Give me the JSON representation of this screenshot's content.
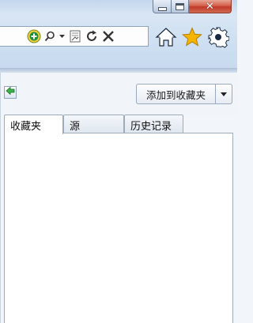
{
  "window": {
    "controls": {
      "minimize_icon": "minimize-icon",
      "maximize_icon": "restore-icon",
      "close_icon": "close-icon",
      "close_glyph": "✕"
    },
    "close_color": "#c0392b"
  },
  "address_bar": {
    "icons": [
      "add-site-icon",
      "search-icon",
      "dropdown-icon",
      "compat-view-icon",
      "refresh-icon",
      "stop-icon"
    ]
  },
  "toolbar": {
    "icons": [
      "home-icon",
      "favorites-star-icon",
      "settings-gear-icon"
    ],
    "star_color": "#f5b400"
  },
  "favorites_center": {
    "back_icon": "green-back-arrow-icon",
    "add_button_label": "添加到收藏夹",
    "tabs": [
      {
        "label": "收藏夹",
        "active": true
      },
      {
        "label": "源",
        "active": false
      },
      {
        "label": "历史记录",
        "active": false
      }
    ]
  }
}
